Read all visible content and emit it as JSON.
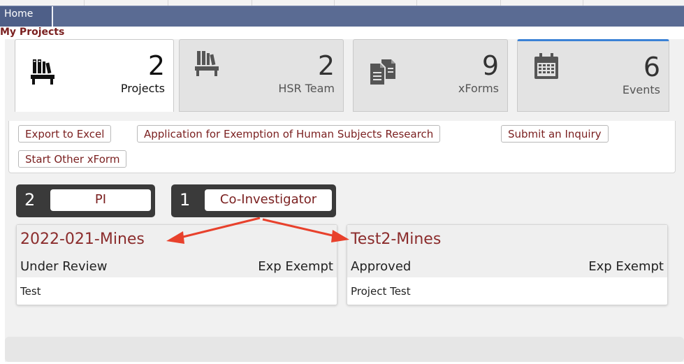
{
  "nav": {
    "home_label": "Home"
  },
  "page": {
    "title": "My Projects"
  },
  "tiles": [
    {
      "count": "2",
      "label": "Projects",
      "icon": "books-icon"
    },
    {
      "count": "2",
      "label": "HSR Team",
      "icon": "books-icon"
    },
    {
      "count": "9",
      "label": "xForms",
      "icon": "documents-icon"
    },
    {
      "count": "6",
      "label": "Events",
      "icon": "calendar-icon"
    }
  ],
  "actions": {
    "export": "Export to Excel",
    "exemption": "Application for Exemption of Human Subjects Research",
    "inquiry": "Submit an Inquiry",
    "other_xform": "Start Other xForm"
  },
  "roles": [
    {
      "count": "2",
      "label": "PI"
    },
    {
      "count": "1",
      "label": "Co-Investigator"
    }
  ],
  "projects": [
    {
      "title": "2022-021-Mines",
      "status": "Under Review",
      "type": "Exp Exempt",
      "description": "Test"
    },
    {
      "title": "Test2-Mines",
      "status": "Approved",
      "type": "Exp Exempt",
      "description": "Project Test"
    }
  ],
  "colors": {
    "accent": "#7a1f1f",
    "nav": "#5a6b93",
    "annotation": "#e8412c",
    "events_border": "#3b82d6"
  }
}
